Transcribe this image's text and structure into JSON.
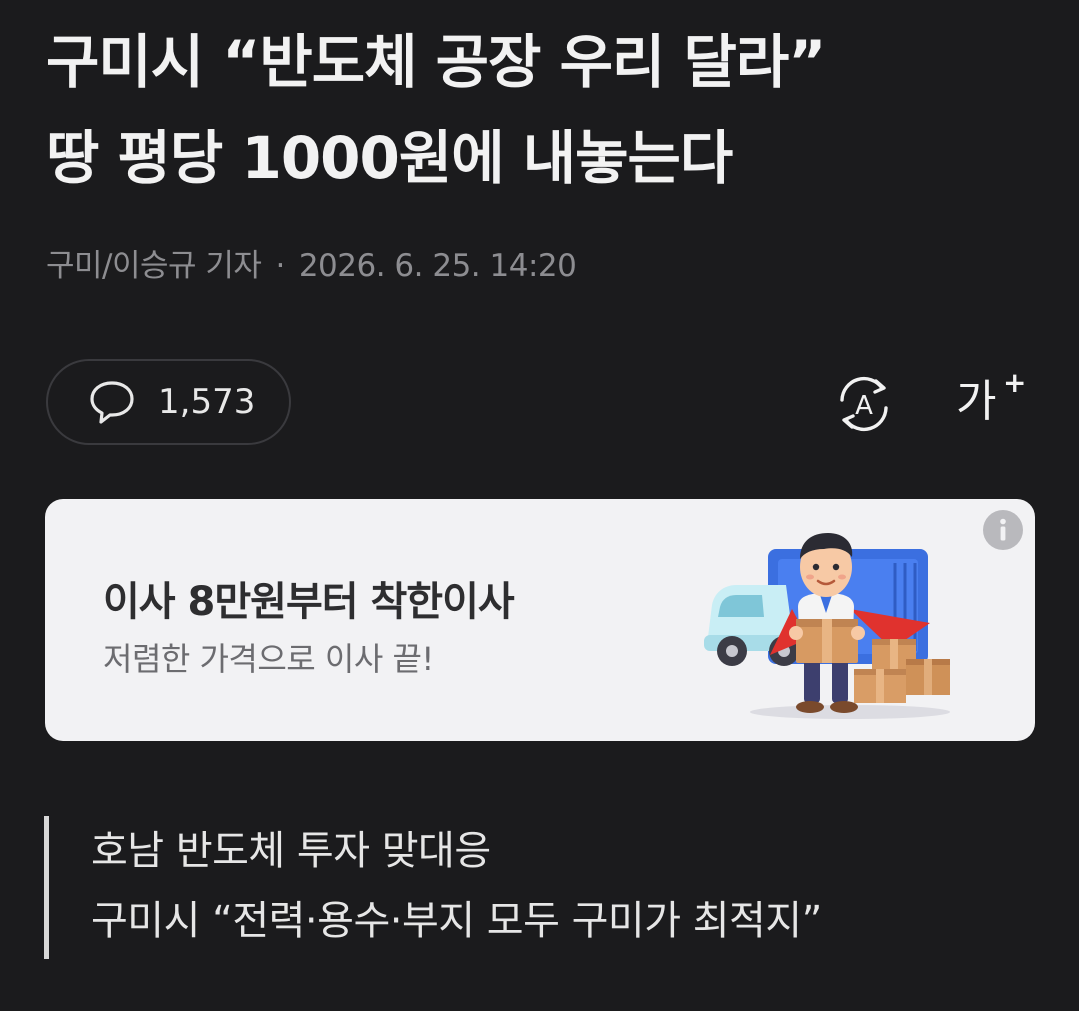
{
  "article": {
    "headline_line1": "구미시 “반도체 공장 우리 달라”",
    "headline_line2": "땅 평당 1000원에 내놓는다",
    "byline": {
      "author": "구미/이승규 기자",
      "separator": "·",
      "datetime": "2026. 6. 25. 14:20"
    },
    "toolbar": {
      "comment_icon": "speech-bubble-icon",
      "comment_count": "1,573",
      "translate_icon": "translate-icon",
      "translate_glyph": "A",
      "font_size_label": "가",
      "font_size_plus": "+"
    },
    "subheadline": {
      "line1": "호남 반도체 투자 맞대응",
      "line2": "구미시 “전력·용수·부지 모두 구미가 최적지”"
    }
  },
  "ad": {
    "title": "이사 8만원부터 착한이사",
    "description": "저렴한 가격으로 이사 끝!",
    "info_icon": "info-icon",
    "info_glyph": "i",
    "illustration": "moving-mascot-with-truck-and-boxes"
  },
  "colors": {
    "background": "#1b1b1d",
    "headline_text": "#f2f2f2",
    "meta_text": "#8d8d91",
    "ad_background": "#f2f2f4",
    "quote_bar": "#d8d8d8"
  }
}
